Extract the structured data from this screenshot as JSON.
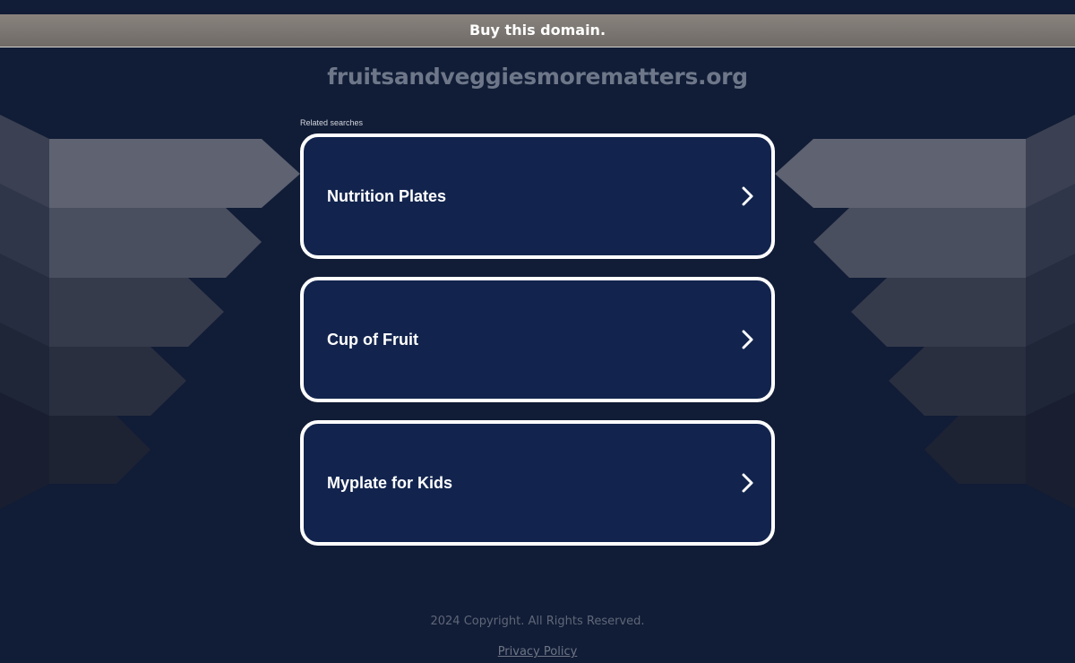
{
  "banner": {
    "text": "Buy this domain."
  },
  "domain": {
    "name": "fruitsandveggiesmorematters.org"
  },
  "searches": {
    "label": "Related searches",
    "items": [
      {
        "label": "Nutrition Plates",
        "icon": "chevron-right-icon"
      },
      {
        "label": "Cup of Fruit",
        "icon": "chevron-right-icon"
      },
      {
        "label": "Myplate for Kids",
        "icon": "chevron-right-icon"
      }
    ]
  },
  "footer": {
    "copyright": "2024 Copyright. All Rights Reserved.",
    "privacy": "Privacy Policy"
  },
  "colors": {
    "page_bg": "#111c36",
    "card_bg": "#12244e",
    "card_border": "#ffffff",
    "banner_bg": "#7c7772"
  }
}
